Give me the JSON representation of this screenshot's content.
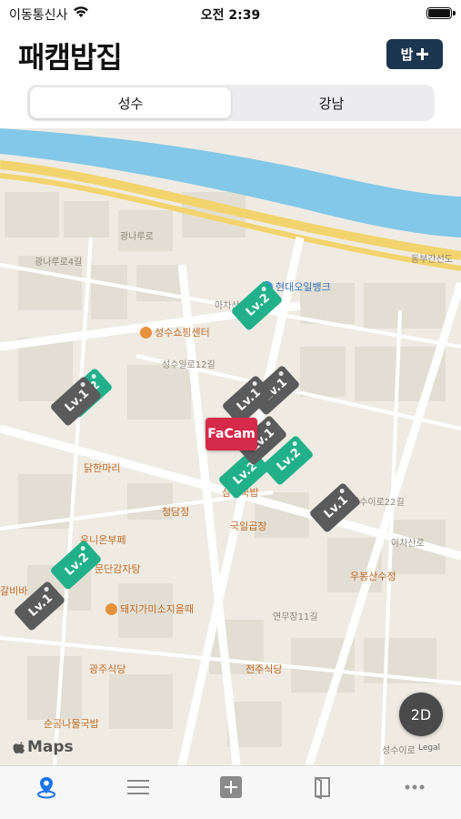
{
  "status": {
    "carrier": "이동통신사",
    "time": "오전 2:39"
  },
  "header": {
    "title": "패캠밥집",
    "add_label": "밥"
  },
  "segments": [
    {
      "label": "성수",
      "active": true
    },
    {
      "label": "강남",
      "active": false
    }
  ],
  "map": {
    "labels": [
      {
        "text": "동부간선도",
        "kind": "road"
      },
      {
        "text": "광나루로",
        "kind": "road"
      },
      {
        "text": "아차산로7길",
        "kind": "road"
      },
      {
        "text": "성수일로12길",
        "kind": "road"
      },
      {
        "text": "성수이로22길",
        "kind": "road"
      },
      {
        "text": "아차산로",
        "kind": "road"
      },
      {
        "text": "연무장11길",
        "kind": "road"
      },
      {
        "text": "성수이로",
        "kind": "road"
      },
      {
        "text": "광나루로4길",
        "kind": "road"
      }
    ],
    "pois": [
      {
        "text": "현대오일뱅크",
        "kind": "blue"
      },
      {
        "text": "성수쇼핑센터",
        "kind": "orange"
      },
      {
        "text": "닭한마리",
        "kind": "orange"
      },
      {
        "text": "청담정",
        "kind": "orange"
      },
      {
        "text": "국일곱창",
        "kind": "orange"
      },
      {
        "text": "유니온부페",
        "kind": "orange"
      },
      {
        "text": "문단감자탕",
        "kind": "orange"
      },
      {
        "text": "돼지가미소지을때",
        "kind": "orange"
      },
      {
        "text": "우봉산수정",
        "kind": "orange"
      },
      {
        "text": "광주식당",
        "kind": "orange"
      },
      {
        "text": "전주식당",
        "kind": "orange"
      },
      {
        "text": "순공나물국밥",
        "kind": "orange"
      },
      {
        "text": "갈비바",
        "kind": "orange"
      },
      {
        "text": "삼숭국밥",
        "kind": "orange"
      }
    ],
    "markers": [
      {
        "label": "Lv.2",
        "level": 2
      },
      {
        "label": "Lv.2",
        "level": 2
      },
      {
        "label": "Lv.1",
        "level": 1
      },
      {
        "label": "Lv.1",
        "level": 1
      },
      {
        "label": "Lv.1",
        "level": 1
      },
      {
        "label": "Lv.2",
        "level": 2
      },
      {
        "label": "Lv.2",
        "level": 2
      },
      {
        "label": "Lv.1",
        "level": 1
      },
      {
        "label": "Lv.2",
        "level": 2
      },
      {
        "label": "Lv.1",
        "level": 1
      },
      {
        "label": "Lv.1",
        "level": 1
      }
    ],
    "selected_marker": "FaCam",
    "attribution": "Maps",
    "legal": "Legal",
    "view_mode": "2D"
  },
  "tabs": [
    {
      "icon": "location-pin-icon",
      "active": true
    },
    {
      "icon": "list-icon",
      "active": false
    },
    {
      "icon": "add-square-icon",
      "active": false
    },
    {
      "icon": "book-icon",
      "active": false
    },
    {
      "icon": "more-icon",
      "active": false
    }
  ],
  "colors": {
    "accent": "#1c3550",
    "lv1": "#5b5b5b",
    "lv2": "#22b08a",
    "selected": "#d52a49",
    "active_tab": "#1a73e8"
  }
}
